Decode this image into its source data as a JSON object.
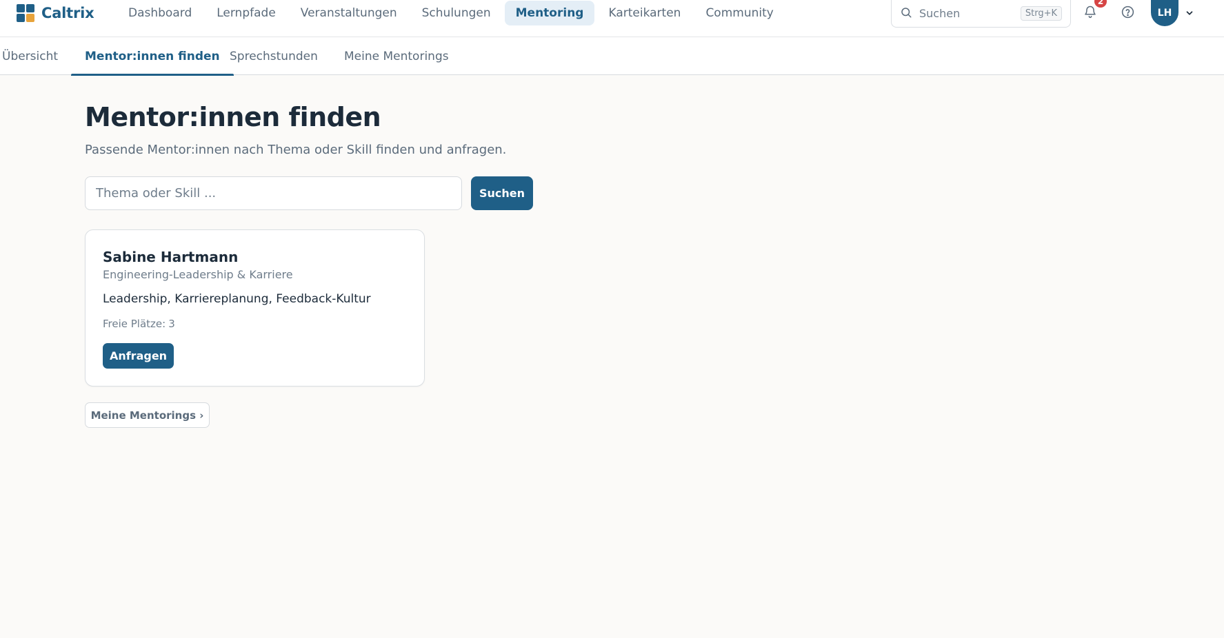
{
  "app": {
    "name": "Caltrix"
  },
  "header": {
    "nav": [
      {
        "label": "Dashboard"
      },
      {
        "label": "Lernpfade"
      },
      {
        "label": "Veranstaltungen"
      },
      {
        "label": "Schulungen"
      },
      {
        "label": "Mentoring",
        "active": true
      },
      {
        "label": "Karteikarten"
      },
      {
        "label": "Community"
      }
    ],
    "search": {
      "placeholder": "Suchen",
      "shortcut": "Strg+K"
    },
    "notifications_count": "2",
    "user_initials": "LH",
    "icons": {
      "search": "search-icon",
      "bell": "bell-icon",
      "help": "help-circle-icon",
      "chevron": "chevron-down-icon"
    }
  },
  "subnav": {
    "tabs": [
      {
        "label": "Übersicht"
      },
      {
        "label": "Mentor:innen finden",
        "active": true
      },
      {
        "label": "Sprechstunden"
      },
      {
        "label": "Meine Mentorings"
      }
    ]
  },
  "main": {
    "title": "Mentor:innen finden",
    "subtitle": "Passende Mentor:innen nach Thema oder Skill finden und anfragen.",
    "search": {
      "placeholder": "Thema oder Skill ...",
      "value": "",
      "button_label": "Suchen"
    },
    "mentors": [
      {
        "name": "Sabine Hartmann",
        "area": "Engineering-Leadership & Karriere",
        "skills": "Leadership, Karriereplanung, Feedback-Kultur",
        "free_slots_label": "Freie Plätze:",
        "free_slots": "3",
        "request_label": "Anfragen"
      }
    ],
    "my_mentorings_link": "Meine Mentorings ›"
  },
  "colors": {
    "primary": "#1f5f87",
    "accent": "#e7a33b",
    "badge": "#d64545",
    "background": "#fbfaf8"
  }
}
